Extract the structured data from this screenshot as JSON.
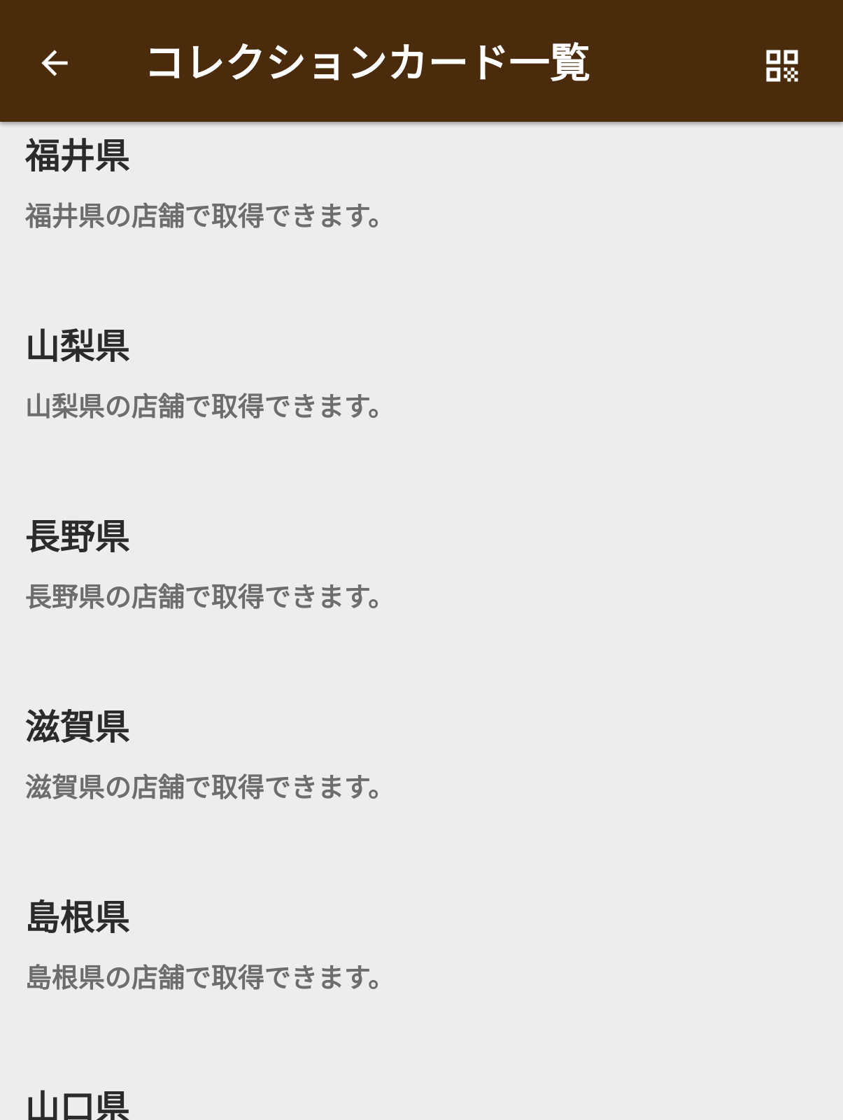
{
  "header": {
    "title": "コレクションカード一覧",
    "back_icon": "arrow-left-icon",
    "qr_icon": "qr-code-icon",
    "background": "#4a2c0d"
  },
  "list": {
    "items": [
      {
        "title": "福井県",
        "description": "福井県の店舗で取得できます。"
      },
      {
        "title": "山梨県",
        "description": "山梨県の店舗で取得できます。"
      },
      {
        "title": "長野県",
        "description": "長野県の店舗で取得できます。"
      },
      {
        "title": "滋賀県",
        "description": "滋賀県の店舗で取得できます。"
      },
      {
        "title": "島根県",
        "description": "島根県の店舗で取得できます。"
      },
      {
        "title": "山口県",
        "description": ""
      }
    ]
  }
}
